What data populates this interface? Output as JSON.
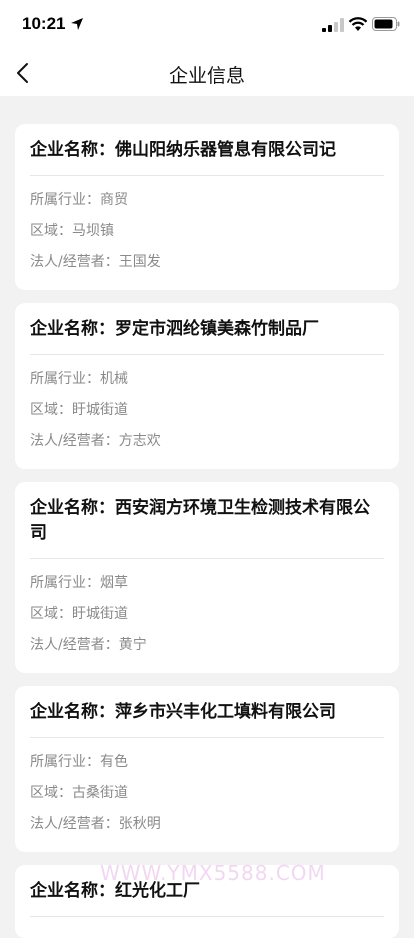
{
  "status": {
    "time": "10:21"
  },
  "nav": {
    "title": "企业信息"
  },
  "labels": {
    "name": "企业名称：",
    "industry": "所属行业：",
    "area": "区域：",
    "legal": "法人/经营者："
  },
  "companies": [
    {
      "name": "佛山阳纳乐器管息有限公司记",
      "industry": "商贸",
      "area": "马坝镇",
      "legal": "王国发"
    },
    {
      "name": "罗定市泗纶镇美森竹制品厂",
      "industry": "机械",
      "area": "盱城街道",
      "legal": "方志欢"
    },
    {
      "name": "西安润方环境卫生检测技术有限公司",
      "industry": "烟草",
      "area": "盱城街道",
      "legal": "黄宁"
    },
    {
      "name": "萍乡市兴丰化工填料有限公司",
      "industry": "有色",
      "area": "古桑街道",
      "legal": "张秋明"
    },
    {
      "name": "红光化工厂",
      "industry": "",
      "area": "",
      "legal": ""
    }
  ],
  "watermark": "WWW.YMX5588.COM"
}
